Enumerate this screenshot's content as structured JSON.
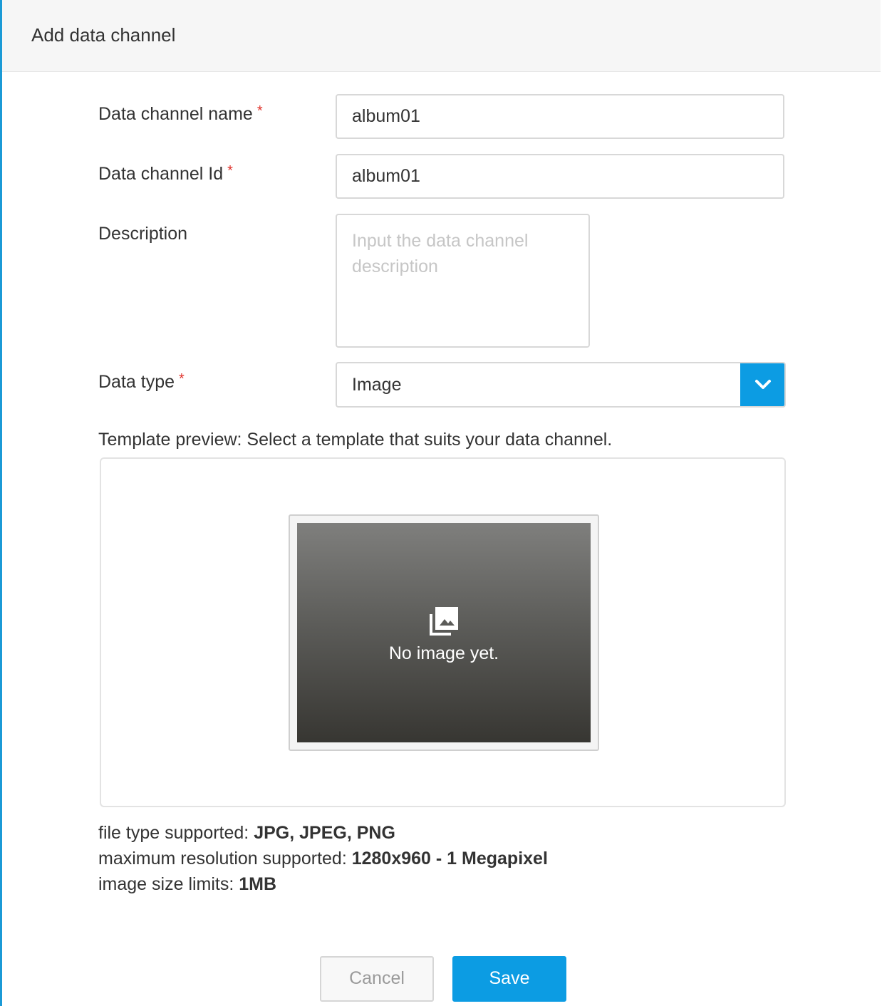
{
  "dialog": {
    "title": "Add data channel"
  },
  "form": {
    "name_label": "Data channel name",
    "name_value": "album01",
    "id_label": "Data channel Id",
    "id_value": "album01",
    "description_label": "Description",
    "description_placeholder": "Input the data channel description",
    "data_type_label": "Data type",
    "data_type_value": "Image",
    "required_marker": "*"
  },
  "template": {
    "label": "Template preview: Select a template that suits your data channel.",
    "empty_text": "No image yet.",
    "icon": "photo-library-icon"
  },
  "info": {
    "file_type_label": "file type supported: ",
    "file_type_value": "JPG, JPEG, PNG",
    "resolution_label": "maximum resolution supported: ",
    "resolution_value": "1280x960 - 1 Megapixel",
    "size_label": "image size limits: ",
    "size_value": "1MB"
  },
  "actions": {
    "cancel_label": "Cancel",
    "save_label": "Save"
  },
  "colors": {
    "accent": "#0c9ce3",
    "required": "#e0322b"
  }
}
